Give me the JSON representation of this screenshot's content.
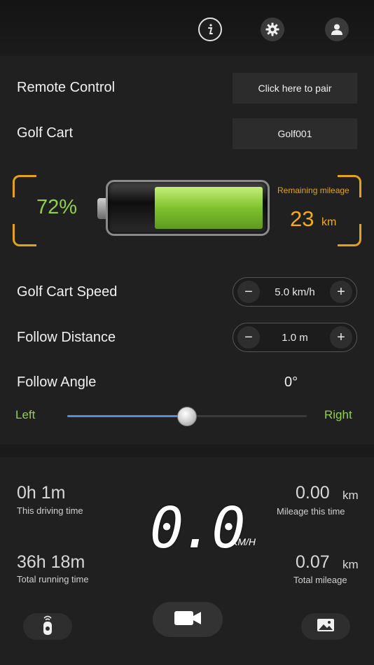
{
  "header": {
    "icons": [
      "info-icon",
      "gear-icon",
      "user-icon"
    ]
  },
  "remote": {
    "label": "Remote Control",
    "button": "Click here to pair"
  },
  "cart": {
    "label": "Golf Cart",
    "value": "Golf001"
  },
  "battery": {
    "percent_text": "72%",
    "level": 0.72,
    "mileage_label": "Remaining mileage",
    "mileage_value": "23",
    "mileage_unit": "km"
  },
  "speed": {
    "label": "Golf Cart Speed",
    "minus": "−",
    "value": "5.0 km/h",
    "plus": "+"
  },
  "distance": {
    "label": "Follow Distance",
    "minus": "−",
    "value": "1.0 m",
    "plus": "+"
  },
  "angle": {
    "label": "Follow Angle",
    "value": "0°",
    "left": "Left",
    "right": "Right",
    "position": 0.5
  },
  "stats": {
    "driving_time": {
      "value": "0h 1m",
      "label": "This driving time"
    },
    "mileage_this": {
      "value": "0.00",
      "unit": "km",
      "label": "Mileage this time"
    },
    "running_time": {
      "value": "36h 18m",
      "label": "Total running time"
    },
    "total_mileage": {
      "value": "0.07",
      "unit": "km",
      "label": "Total mileage"
    },
    "current_speed": {
      "value": "0.0",
      "unit": "KM/H"
    }
  },
  "bottom": {
    "icons": [
      "remote-icon",
      "video-camera-icon",
      "gallery-icon"
    ]
  },
  "colors": {
    "accent_green": "#8fd14a",
    "accent_orange": "#e3a21a",
    "slider_blue": "#5b8ad6"
  }
}
